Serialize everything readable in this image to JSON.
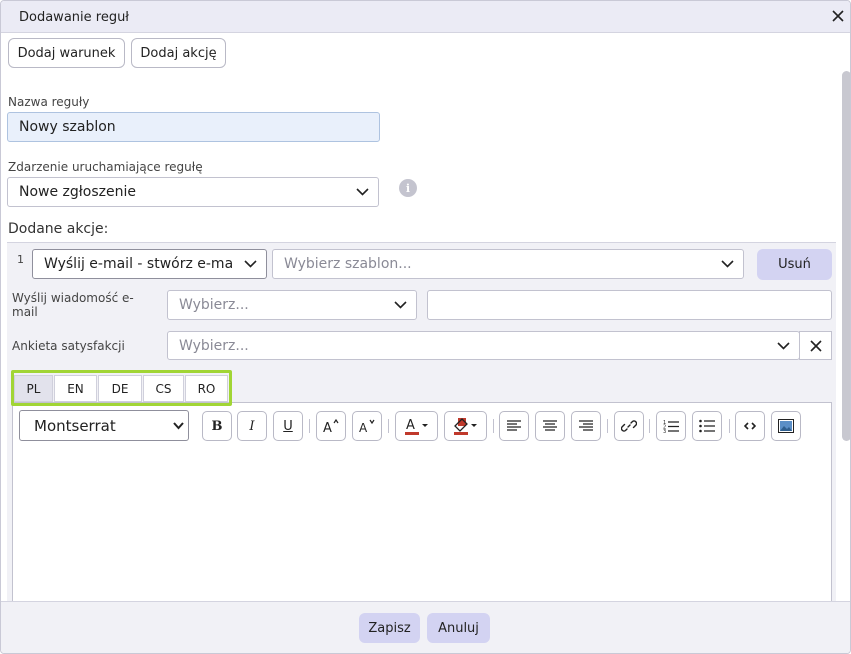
{
  "dialog": {
    "title": "Dodawanie reguł"
  },
  "toolbar": {
    "add_condition": "Dodaj warunek",
    "add_action": "Dodaj akcję"
  },
  "rule_name": {
    "label": "Nazwa reguły",
    "value": "Nowy szablon"
  },
  "trigger": {
    "label": "Zdarzenie uruchamiające regułę",
    "value": "Nowe zgłoszenie",
    "info_icon": "i"
  },
  "actions": {
    "label": "Dodane akcje:",
    "items": [
      {
        "number": "1",
        "action_value": "Wyślij e-mail - stwórz e-ma",
        "template_placeholder": "Wybierz szablon...",
        "remove_label": "Usuń",
        "send_email_label_line1": "Wyślij wiadomość e-",
        "send_email_label_line2": "mail",
        "send_email_placeholder": "Wybierz...",
        "survey_label": "Ankieta satysfakcji",
        "survey_placeholder": "Wybierz..."
      }
    ]
  },
  "languages": [
    "PL",
    "EN",
    "DE",
    "CS",
    "RO"
  ],
  "active_language": "PL",
  "editor": {
    "font": "Montserrat",
    "bold": "B",
    "italic": "I",
    "underline": "U"
  },
  "footer": {
    "save": "Zapisz",
    "cancel": "Anuluj"
  },
  "colors": {
    "accent": "#d3d3f2",
    "highlight_outline": "#a1d535",
    "input_filled": "#e9f0fb",
    "text_color_bar": "#c0392b"
  }
}
